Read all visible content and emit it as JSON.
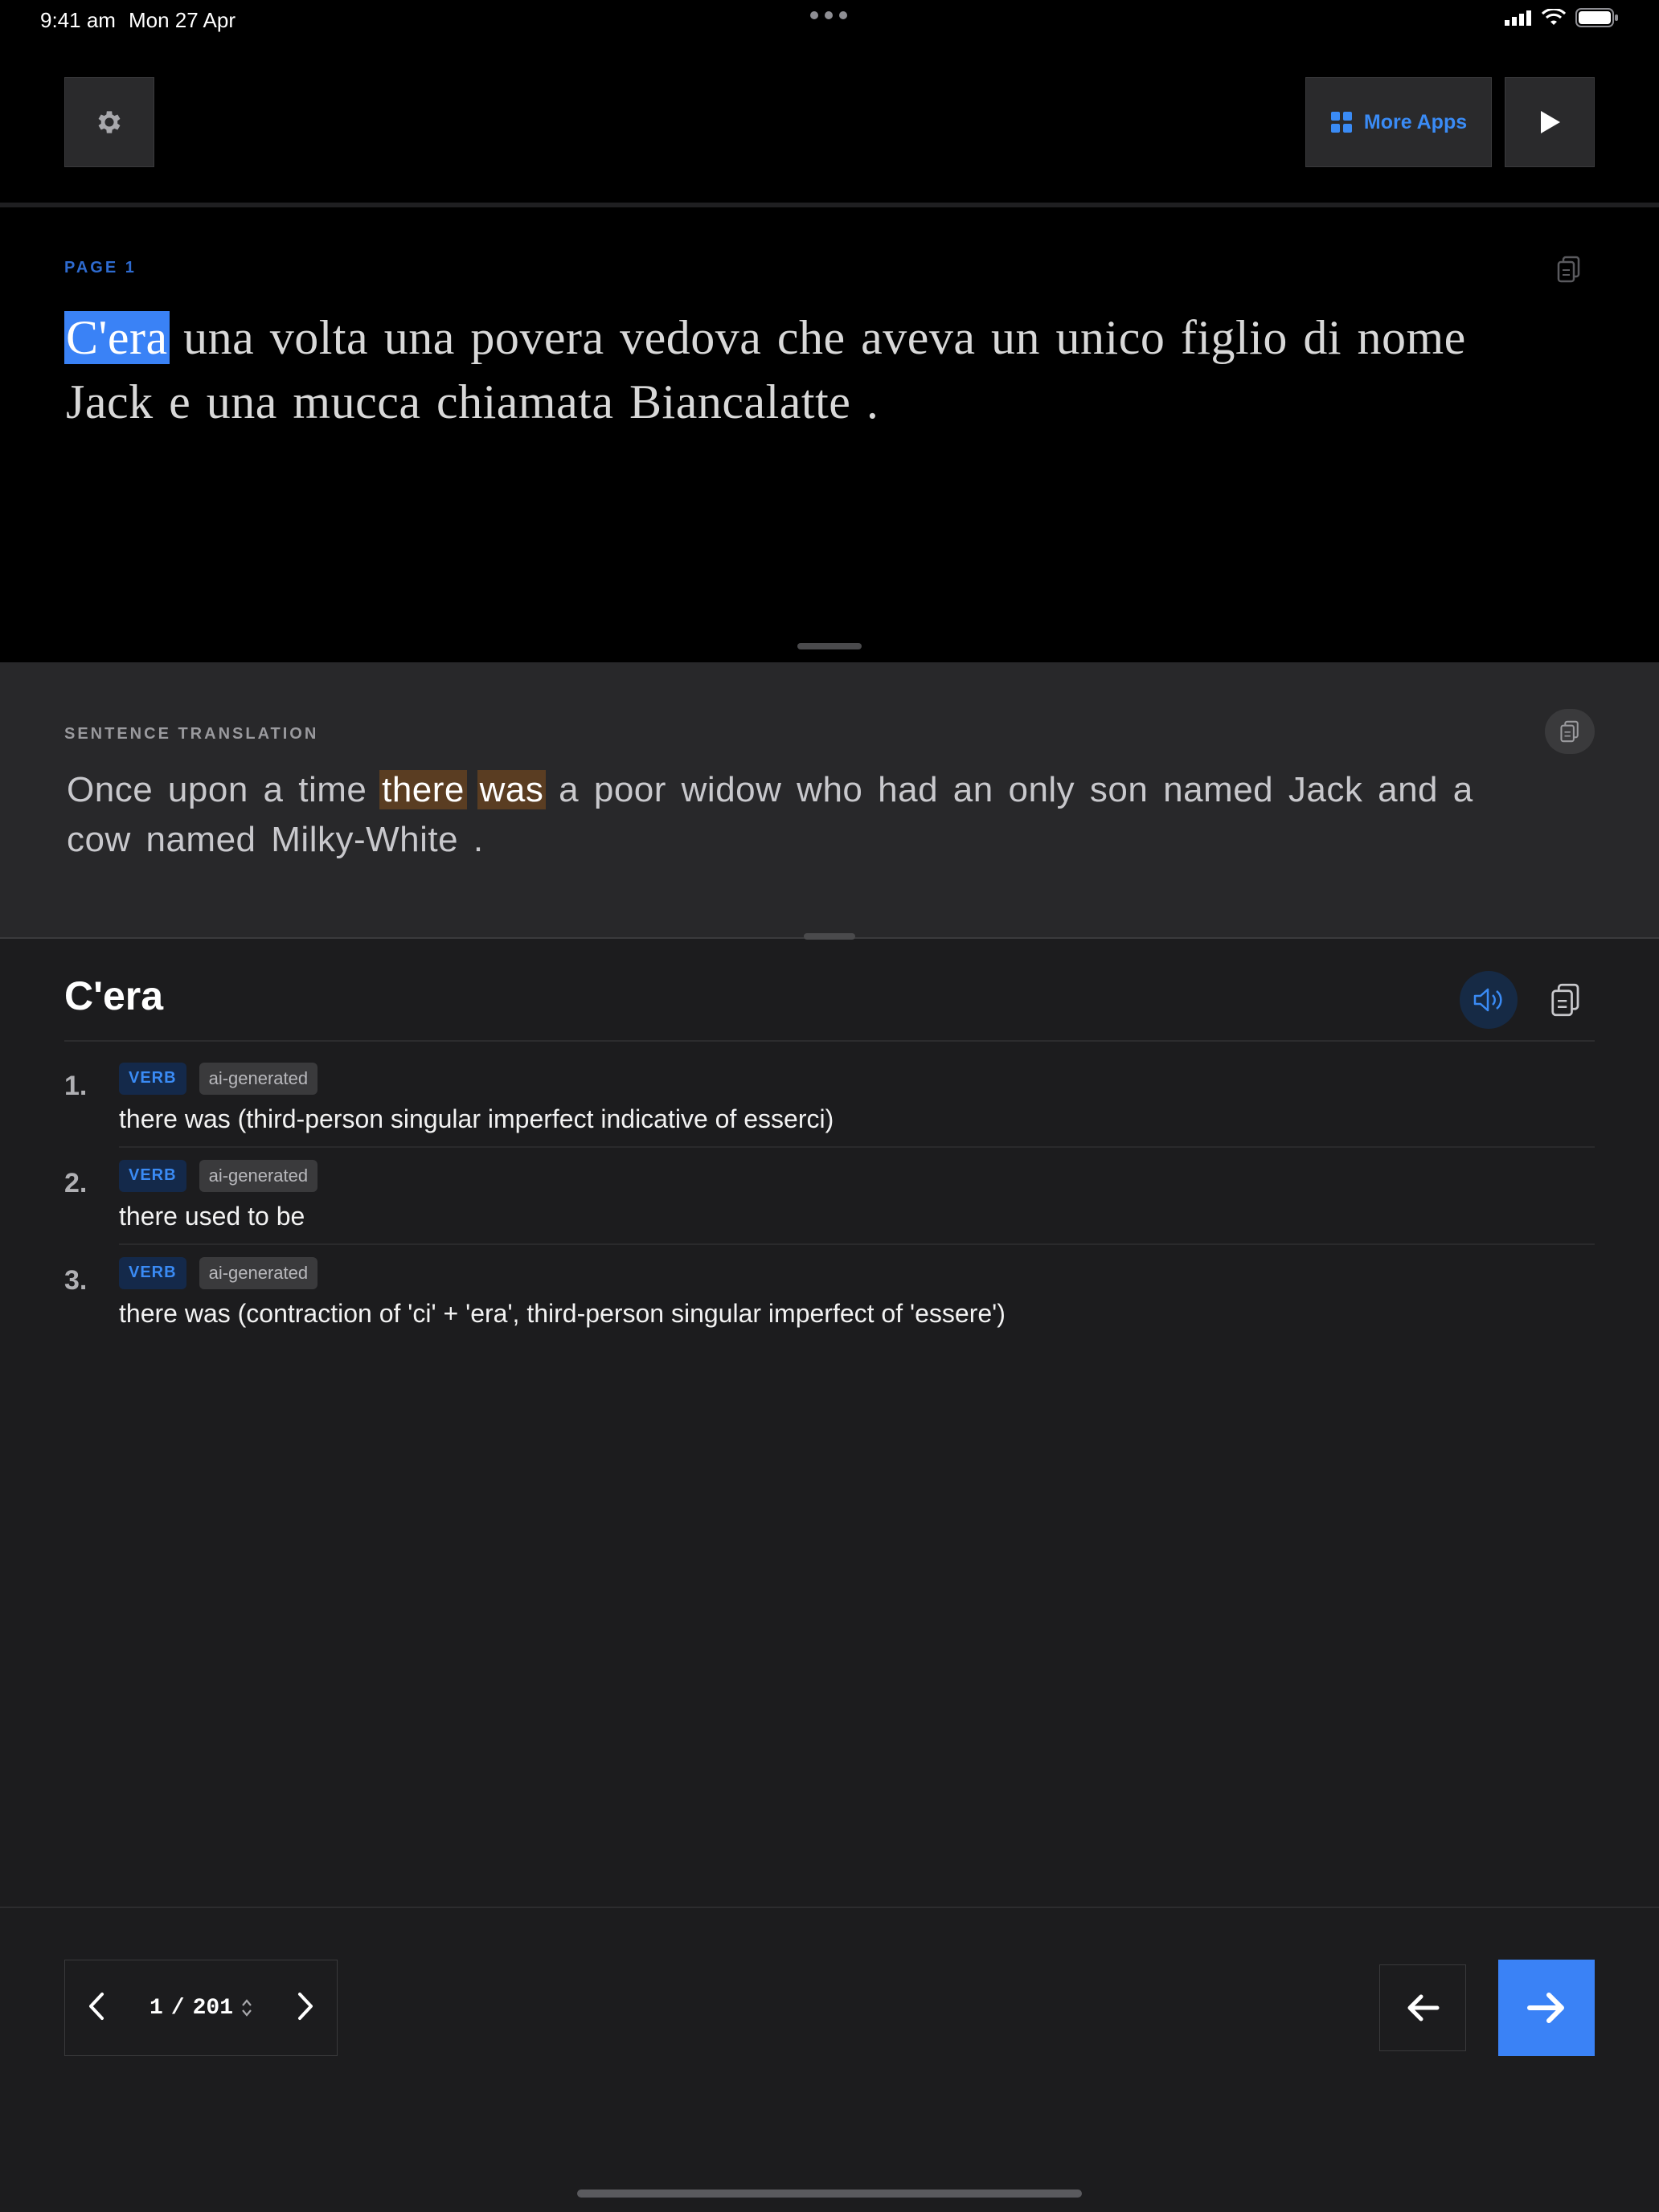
{
  "status_bar": {
    "time": "9:41 am",
    "date": "Mon 27 Apr"
  },
  "toolbar": {
    "more_apps_label": "More Apps"
  },
  "reader": {
    "page_label": "PAGE 1",
    "source_words": [
      "C'era",
      "una",
      "volta",
      "una",
      "povera",
      "vedova",
      "che",
      "aveva",
      "un",
      "unico",
      "figlio",
      "di",
      "nome",
      "Jack",
      "e",
      "una",
      "mucca",
      "chiamata",
      "Biancalatte",
      "."
    ],
    "selected_index": 0
  },
  "translation": {
    "label": "SENTENCE TRANSLATION",
    "words": [
      "Once",
      "upon",
      "a",
      "time",
      "there",
      "was",
      "a",
      "poor",
      "widow",
      "who",
      "had",
      "an",
      "only",
      "son",
      "named",
      "Jack",
      "and",
      "a",
      "cow",
      "named",
      "Milky-White",
      "."
    ],
    "highlighted_indices": [
      4,
      5
    ]
  },
  "dictionary": {
    "word": "C'era",
    "definitions": [
      {
        "num": "1.",
        "pos": "VERB",
        "tag": "ai-generated",
        "gloss": "there was (third-person singular imperfect indicative of esserci)"
      },
      {
        "num": "2.",
        "pos": "VERB",
        "tag": "ai-generated",
        "gloss": "there used to be"
      },
      {
        "num": "3.",
        "pos": "VERB",
        "tag": "ai-generated",
        "gloss": "there was (contraction of 'ci' + 'era', third-person singular imperfect of 'essere')"
      }
    ]
  },
  "pager": {
    "current": "1",
    "separator": "/",
    "total": "201"
  },
  "colors": {
    "accent": "#3a82f6",
    "source_highlight": "#3a82f6",
    "translation_highlight": "#5a3d22"
  },
  "icons": [
    "gear-icon",
    "grid-icon",
    "play-icon",
    "copy-icon",
    "speaker-icon",
    "chevron-left-icon",
    "chevron-right-icon",
    "sort-icon",
    "arrow-left-icon",
    "arrow-right-icon",
    "signal-icon",
    "wifi-icon",
    "battery-icon"
  ]
}
